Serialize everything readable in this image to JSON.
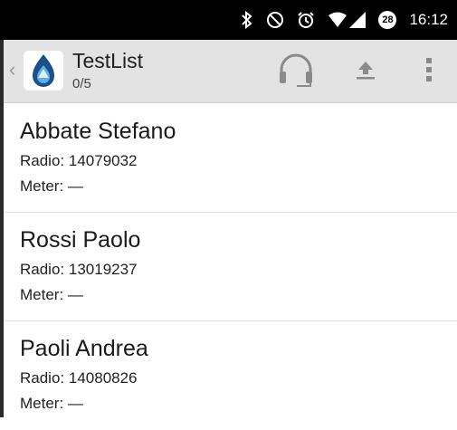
{
  "status_bar": {
    "time": "16:12",
    "notification_count": "28",
    "icons": [
      "bluetooth-icon",
      "do-not-disturb-icon",
      "alarm-icon",
      "wifi-icon",
      "signal-icon"
    ]
  },
  "action_bar": {
    "title": "TestList",
    "subtitle": "0/5",
    "actions": [
      "headphones-icon",
      "upload-icon",
      "overflow-menu-icon"
    ]
  },
  "list": {
    "items": [
      {
        "name": "Abbate Stefano",
        "radio_label": "Radio:",
        "radio": "14079032",
        "meter_label": "Meter:",
        "meter": "—"
      },
      {
        "name": "Rossi Paolo",
        "radio_label": "Radio:",
        "radio": "13019237",
        "meter_label": "Meter:",
        "meter": "—"
      },
      {
        "name": "Paoli Andrea",
        "radio_label": "Radio:",
        "radio": "14080826",
        "meter_label": "Meter:",
        "meter": "—"
      }
    ]
  },
  "colors": {
    "status_bar_bg": "#000000",
    "action_bar_bg": "#e3e3e3",
    "icon_gray": "#8a8a8a",
    "brand_blue": "#2a6fb0"
  }
}
